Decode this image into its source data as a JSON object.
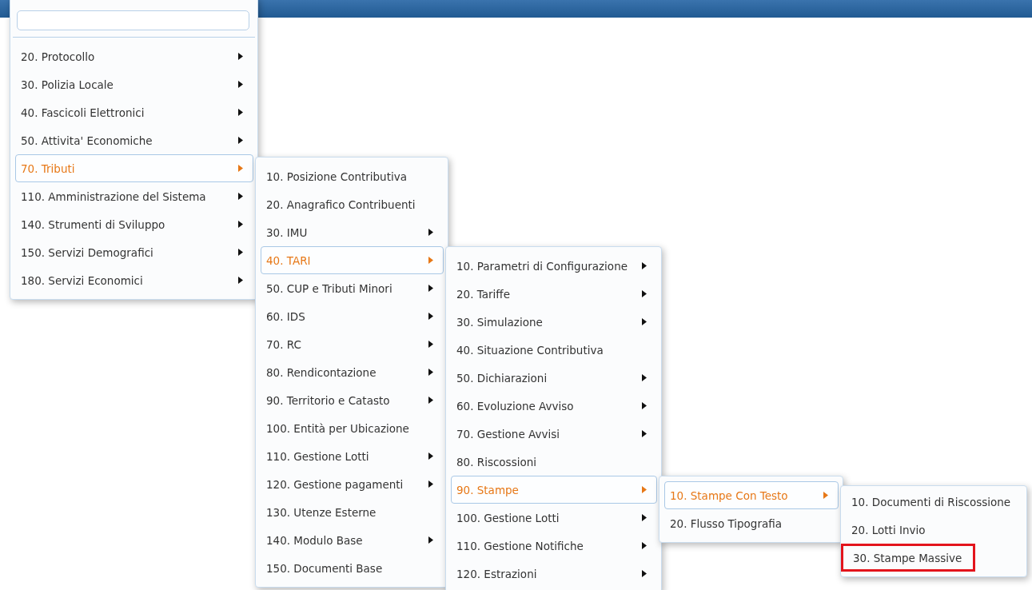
{
  "menu": {
    "has_search": true,
    "items": [
      {
        "label": "20. Protocollo",
        "has_submenu": true,
        "selected": false
      },
      {
        "label": "30. Polizia Locale",
        "has_submenu": true,
        "selected": false
      },
      {
        "label": "40. Fascicoli Elettronici",
        "has_submenu": true,
        "selected": false
      },
      {
        "label": "50. Attivita' Economiche",
        "has_submenu": true,
        "selected": false
      },
      {
        "label": "70. Tributi",
        "has_submenu": true,
        "selected": true,
        "children": [
          {
            "label": "10. Posizione Contributiva",
            "has_submenu": false,
            "selected": false
          },
          {
            "label": "20. Anagrafico Contribuenti",
            "has_submenu": false,
            "selected": false
          },
          {
            "label": "30. IMU",
            "has_submenu": true,
            "selected": false
          },
          {
            "label": "40. TARI",
            "has_submenu": true,
            "selected": true,
            "children": [
              {
                "label": "10. Parametri di Configurazione",
                "has_submenu": true,
                "selected": false
              },
              {
                "label": "20. Tariffe",
                "has_submenu": true,
                "selected": false
              },
              {
                "label": "30. Simulazione",
                "has_submenu": true,
                "selected": false
              },
              {
                "label": "40. Situazione Contributiva",
                "has_submenu": false,
                "selected": false
              },
              {
                "label": "50. Dichiarazioni",
                "has_submenu": true,
                "selected": false
              },
              {
                "label": "60. Evoluzione Avviso",
                "has_submenu": true,
                "selected": false
              },
              {
                "label": "70. Gestione Avvisi",
                "has_submenu": true,
                "selected": false
              },
              {
                "label": "80. Riscossioni",
                "has_submenu": false,
                "selected": false
              },
              {
                "label": "90. Stampe",
                "has_submenu": true,
                "selected": true,
                "children": [
                  {
                    "label": "10. Stampe Con Testo",
                    "has_submenu": true,
                    "selected": true,
                    "children": [
                      {
                        "label": "10. Documenti di Riscossione",
                        "has_submenu": false,
                        "selected": false,
                        "highlighted": false
                      },
                      {
                        "label": "20. Lotti Invio",
                        "has_submenu": false,
                        "selected": false,
                        "highlighted": false
                      },
                      {
                        "label": "30. Stampe Massive",
                        "has_submenu": false,
                        "selected": false,
                        "highlighted": true
                      }
                    ]
                  },
                  {
                    "label": "20. Flusso Tipografia",
                    "has_submenu": false,
                    "selected": false
                  }
                ]
              },
              {
                "label": "100. Gestione Lotti",
                "has_submenu": true,
                "selected": false
              },
              {
                "label": "110. Gestione Notifiche",
                "has_submenu": true,
                "selected": false
              },
              {
                "label": "120. Estrazioni",
                "has_submenu": true,
                "selected": false
              }
            ]
          },
          {
            "label": "50. CUP e Tributi Minori",
            "has_submenu": true,
            "selected": false
          },
          {
            "label": "60. IDS",
            "has_submenu": true,
            "selected": false
          },
          {
            "label": "70. RC",
            "has_submenu": true,
            "selected": false
          },
          {
            "label": "80. Rendicontazione",
            "has_submenu": true,
            "selected": false
          },
          {
            "label": "90. Territorio e Catasto",
            "has_submenu": true,
            "selected": false
          },
          {
            "label": "100. Entità per Ubicazione",
            "has_submenu": false,
            "selected": false
          },
          {
            "label": "110. Gestione Lotti",
            "has_submenu": true,
            "selected": false
          },
          {
            "label": "120. Gestione pagamenti",
            "has_submenu": true,
            "selected": false
          },
          {
            "label": "130. Utenze Esterne",
            "has_submenu": false,
            "selected": false
          },
          {
            "label": "140. Modulo Base",
            "has_submenu": true,
            "selected": false
          },
          {
            "label": "150. Documenti Base",
            "has_submenu": false,
            "selected": false
          }
        ]
      },
      {
        "label": "110. Amministrazione del Sistema",
        "has_submenu": true,
        "selected": false
      },
      {
        "label": "140. Strumenti di Sviluppo",
        "has_submenu": true,
        "selected": false
      },
      {
        "label": "150. Servizi Demografici",
        "has_submenu": true,
        "selected": false
      },
      {
        "label": "180. Servizi Economici",
        "has_submenu": true,
        "selected": false
      }
    ]
  }
}
